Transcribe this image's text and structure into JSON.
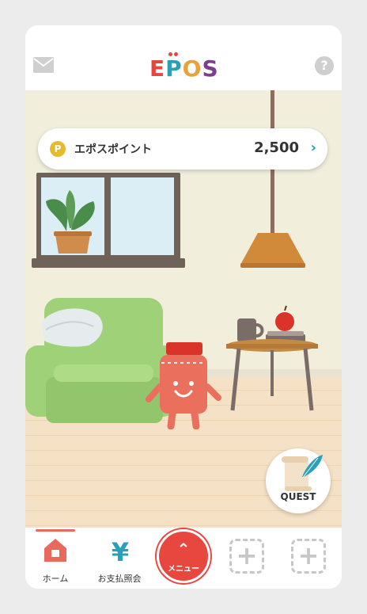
{
  "header": {
    "logo_letters": [
      "E",
      "P",
      "O",
      "S"
    ],
    "mail_icon": "mail-icon",
    "help_icon": "question-icon",
    "help_glyph": "?"
  },
  "points": {
    "coin_glyph": "P",
    "label": "エポスポイント",
    "value": "2,500",
    "chevron": "›"
  },
  "quest": {
    "label": "QUEST"
  },
  "nav": {
    "home_label": "ホーム",
    "payment_label": "お支払照会",
    "payment_glyph": "¥",
    "menu_label": "メニュー",
    "menu_glyph": "⌃",
    "slot_glyph": "+"
  },
  "colors": {
    "accent_red": "#e7473e",
    "accent_teal": "#2aa0b6",
    "coin_yellow": "#e7b92e",
    "logo": [
      "#e2483d",
      "#2aa0b6",
      "#e9a23b",
      "#7b3f8e"
    ]
  }
}
